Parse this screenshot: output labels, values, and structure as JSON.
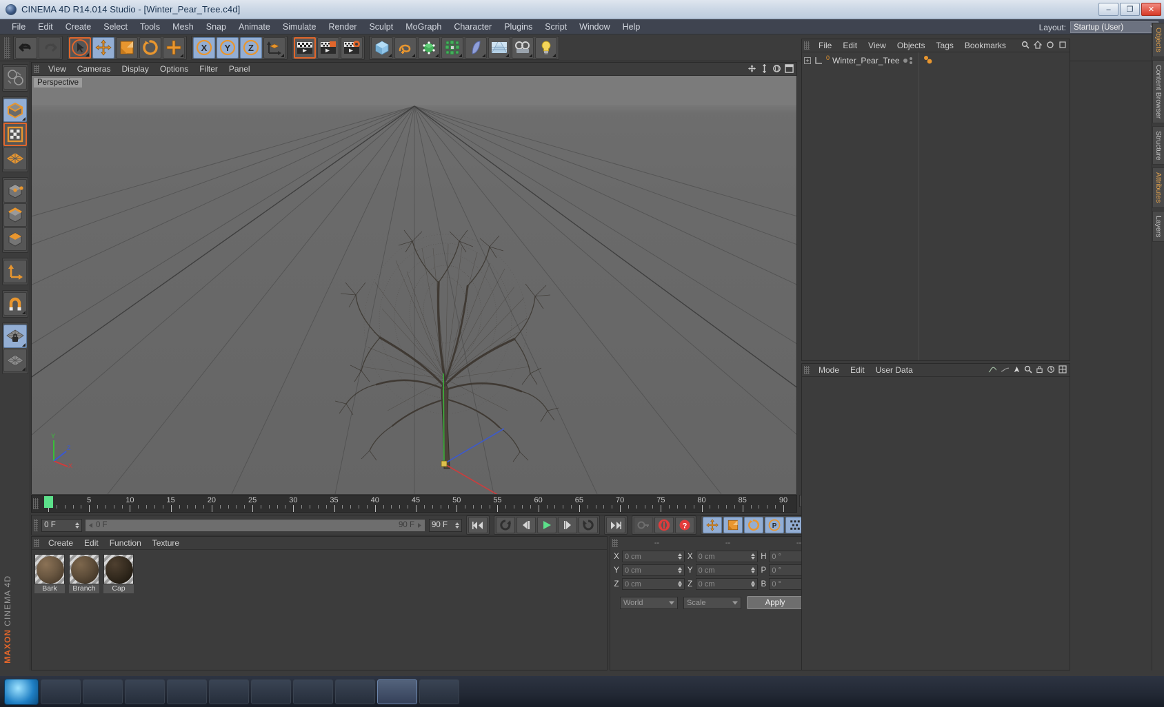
{
  "window": {
    "title": "CINEMA 4D R14.014 Studio - [Winter_Pear_Tree.c4d]",
    "app_icon": "c4d-logo-icon",
    "minimize_label": "–",
    "maximize_label": "❐",
    "close_label": "✕"
  },
  "menubar": {
    "items": [
      "File",
      "Edit",
      "Create",
      "Select",
      "Tools",
      "Mesh",
      "Snap",
      "Animate",
      "Simulate",
      "Render",
      "Sculpt",
      "MoGraph",
      "Character",
      "Plugins",
      "Script",
      "Window",
      "Help"
    ],
    "layout_label": "Layout:",
    "layout_value": "Startup (User)"
  },
  "toolbar": {
    "groups": [
      {
        "name": "history",
        "buttons": [
          {
            "name": "undo-button",
            "icon": "undo-arrow-icon",
            "state": "normal"
          },
          {
            "name": "redo-button",
            "icon": "redo-arrow-icon",
            "state": "disabled"
          }
        ]
      },
      {
        "name": "tools",
        "buttons": [
          {
            "name": "live-selection-button",
            "icon": "cursor-arrow-icon",
            "state": "selected"
          },
          {
            "name": "move-tool-button",
            "icon": "move-cross-icon",
            "state": "active"
          },
          {
            "name": "scale-tool-button",
            "icon": "scale-square-icon",
            "state": "normal"
          },
          {
            "name": "rotate-tool-button",
            "icon": "rotate-circle-icon",
            "state": "normal"
          },
          {
            "name": "add-tool-button",
            "icon": "plus-cross-icon",
            "state": "normal"
          }
        ]
      },
      {
        "name": "axis-locks",
        "buttons": [
          {
            "name": "lock-x-axis-button",
            "icon": "x-axis-icon",
            "state": "active"
          },
          {
            "name": "lock-y-axis-button",
            "icon": "y-axis-icon",
            "state": "active"
          },
          {
            "name": "lock-z-axis-button",
            "icon": "z-axis-icon",
            "state": "active"
          },
          {
            "name": "world-object-coord-button",
            "icon": "world-axis-icon",
            "state": "normal"
          }
        ]
      },
      {
        "name": "render",
        "buttons": [
          {
            "name": "render-view-button",
            "icon": "clapperboard-icon",
            "state": "selected"
          },
          {
            "name": "render-region-button",
            "icon": "clapperboard-region-icon",
            "state": "normal"
          },
          {
            "name": "render-settings-button",
            "icon": "clapperboard-gear-icon",
            "state": "normal"
          }
        ]
      },
      {
        "name": "objects",
        "buttons": [
          {
            "name": "add-cube-button",
            "icon": "cube-icon",
            "state": "normal"
          },
          {
            "name": "add-spline-button",
            "icon": "spline-icon",
            "state": "normal"
          },
          {
            "name": "add-nurbs-button",
            "icon": "green-cube-icon",
            "state": "normal"
          },
          {
            "name": "add-array-button",
            "icon": "array-icon",
            "state": "normal"
          },
          {
            "name": "add-deformer-button",
            "icon": "bend-deformer-icon",
            "state": "normal"
          },
          {
            "name": "add-environment-button",
            "icon": "floor-environment-icon",
            "state": "normal"
          },
          {
            "name": "add-camera-button",
            "icon": "camera-icon",
            "state": "normal"
          },
          {
            "name": "add-light-button",
            "icon": "lightbulb-icon",
            "state": "normal"
          }
        ]
      }
    ]
  },
  "leftbar": {
    "buttons": [
      {
        "name": "undo-view-button",
        "icon": "globe-undo-icon",
        "state": "normal"
      },
      {
        "name": "model-mode-button",
        "icon": "model-cube-icon",
        "state": "active"
      },
      {
        "name": "texture-mode-button",
        "icon": "texture-checker-icon",
        "state": "selected"
      },
      {
        "name": "workplane-button",
        "icon": "workplane-grid-icon",
        "state": "normal"
      },
      {
        "name": "points-mode-button",
        "icon": "points-cube-icon",
        "state": "normal"
      },
      {
        "name": "edges-mode-button",
        "icon": "edges-cube-icon",
        "state": "normal"
      },
      {
        "name": "polygons-mode-button",
        "icon": "polygons-cube-icon",
        "state": "normal"
      },
      {
        "name": "axis-modify-button",
        "icon": "axis-corner-icon",
        "state": "normal"
      },
      {
        "name": "enable-snap-button",
        "icon": "magnet-icon",
        "state": "normal"
      },
      {
        "name": "lock-workplane-button",
        "icon": "grid-lock-icon",
        "state": "active"
      },
      {
        "name": "workplane-mode-button",
        "icon": "grid-plane-icon",
        "state": "normal"
      }
    ],
    "brand_top": "MAXON",
    "brand_bottom": "CINEMA 4D"
  },
  "viewport": {
    "menu_items": [
      "View",
      "Cameras",
      "Display",
      "Options",
      "Filter",
      "Panel"
    ],
    "camera_label": "Perspective",
    "right_icons": [
      "pan-view-icon",
      "zoom-view-icon",
      "rotate-view-icon",
      "maximize-view-icon"
    ],
    "axis_labels": {
      "x": "X",
      "y": "Y",
      "z": "Z"
    },
    "axis_colors": {
      "x": "#d94040",
      "y": "#3fbf3f",
      "z": "#4060e0"
    }
  },
  "timeline": {
    "ticks": [
      {
        "label": "0",
        "value": 0
      },
      {
        "label": "5",
        "value": 5
      },
      {
        "label": "10",
        "value": 10
      },
      {
        "label": "15",
        "value": 15
      },
      {
        "label": "20",
        "value": 20
      },
      {
        "label": "25",
        "value": 25
      },
      {
        "label": "30",
        "value": 30
      },
      {
        "label": "35",
        "value": 35
      },
      {
        "label": "40",
        "value": 40
      },
      {
        "label": "45",
        "value": 45
      },
      {
        "label": "50",
        "value": 50
      },
      {
        "label": "55",
        "value": 55
      },
      {
        "label": "60",
        "value": 60
      },
      {
        "label": "65",
        "value": 65
      },
      {
        "label": "70",
        "value": 70
      },
      {
        "label": "75",
        "value": 75
      },
      {
        "label": "80",
        "value": 80
      },
      {
        "label": "85",
        "value": 85
      },
      {
        "label": "90",
        "value": 90
      }
    ],
    "range_start": 0,
    "range_end": 90,
    "playhead_frame": 0,
    "end_field_value": "0 F"
  },
  "transport": {
    "current_frame": "0 F",
    "preview_start": "0 F",
    "preview_end": "90 F",
    "document_end": "90 F",
    "buttons": [
      {
        "name": "go-to-start-button",
        "icon": "skip-back-icon",
        "state": "normal"
      },
      {
        "name": "play-backwards-loop-button",
        "icon": "loop-back-icon",
        "state": "normal"
      },
      {
        "name": "previous-frame-button",
        "icon": "step-back-icon",
        "state": "normal"
      },
      {
        "name": "play-button",
        "icon": "play-icon",
        "state": "normal"
      },
      {
        "name": "next-frame-button",
        "icon": "step-forward-icon",
        "state": "normal"
      },
      {
        "name": "play-forwards-loop-button",
        "icon": "loop-forward-icon",
        "state": "normal"
      },
      {
        "name": "go-to-end-button",
        "icon": "skip-forward-icon",
        "state": "normal"
      },
      {
        "name": "autokeying-button",
        "icon": "key-icon",
        "state": "disabled"
      },
      {
        "name": "record-active-objects-button",
        "icon": "record-circle-icon",
        "state": "normal"
      },
      {
        "name": "keyframe-help-button",
        "icon": "question-icon",
        "state": "normal"
      },
      {
        "name": "record-position-button",
        "icon": "move-cross-icon",
        "state": "active"
      },
      {
        "name": "record-scale-button",
        "icon": "scale-square-icon",
        "state": "active"
      },
      {
        "name": "record-rotation-button",
        "icon": "rotate-circle-icon",
        "state": "active"
      },
      {
        "name": "record-param-button",
        "icon": "p-circle-icon",
        "state": "active"
      },
      {
        "name": "record-pla-button",
        "icon": "pla-dots-icon",
        "state": "active"
      },
      {
        "name": "keyframe-selection-button",
        "icon": "keyframe-select-icon",
        "state": "active"
      }
    ]
  },
  "material_manager": {
    "menu_items": [
      "Create",
      "Edit",
      "Function",
      "Texture"
    ],
    "materials": [
      {
        "name": "Bark",
        "color": "#6b5842"
      },
      {
        "name": "Branch",
        "color": "#5f4e3a"
      },
      {
        "name": "Cap",
        "color": "#3a2e20"
      }
    ]
  },
  "coordinate_manager": {
    "headers": [
      "--",
      "--",
      "--"
    ],
    "rows": [
      {
        "pos_label": "X",
        "pos_value": "0 cm",
        "size_label": "X",
        "size_value": "0 cm",
        "rot_label": "H",
        "rot_value": "0 °"
      },
      {
        "pos_label": "Y",
        "pos_value": "0 cm",
        "size_label": "Y",
        "size_value": "0 cm",
        "rot_label": "P",
        "rot_value": "0 °"
      },
      {
        "pos_label": "Z",
        "pos_value": "0 cm",
        "size_label": "Z",
        "size_value": "0 cm",
        "rot_label": "B",
        "rot_value": "0 °"
      }
    ],
    "coord_system": "World",
    "transform_mode": "Scale",
    "apply_label": "Apply"
  },
  "object_manager": {
    "menu_items": [
      "File",
      "Edit",
      "View",
      "Objects",
      "Tags",
      "Bookmarks"
    ],
    "right_icons": [
      "search-icon",
      "home-icon",
      "link-icon",
      "unlink-icon"
    ],
    "objects": [
      {
        "name": "Winter_Pear_Tree",
        "level_badge": "0",
        "visible_dot": "●"
      }
    ]
  },
  "attribute_manager": {
    "menu_items": [
      "Mode",
      "Edit",
      "User Data"
    ],
    "right_icons": [
      "curve-icon",
      "pin-icon",
      "arrow-icon",
      "search-icon",
      "lock-icon",
      "history-icon",
      "layout-icon"
    ]
  },
  "vtabs": [
    {
      "label": "Objects",
      "accent": true
    },
    {
      "label": "Content Browser",
      "accent": false
    },
    {
      "label": "Structure",
      "accent": false
    },
    {
      "label": "Attributes",
      "accent": true
    },
    {
      "label": "Layers",
      "accent": false
    }
  ],
  "colors": {
    "accent_orange": "#e2662b",
    "active_blue": "#93aed4",
    "panel_bg": "#3c3c3c",
    "viewport_bg": "#6a6a6a",
    "play_green": "#5ce08a"
  }
}
